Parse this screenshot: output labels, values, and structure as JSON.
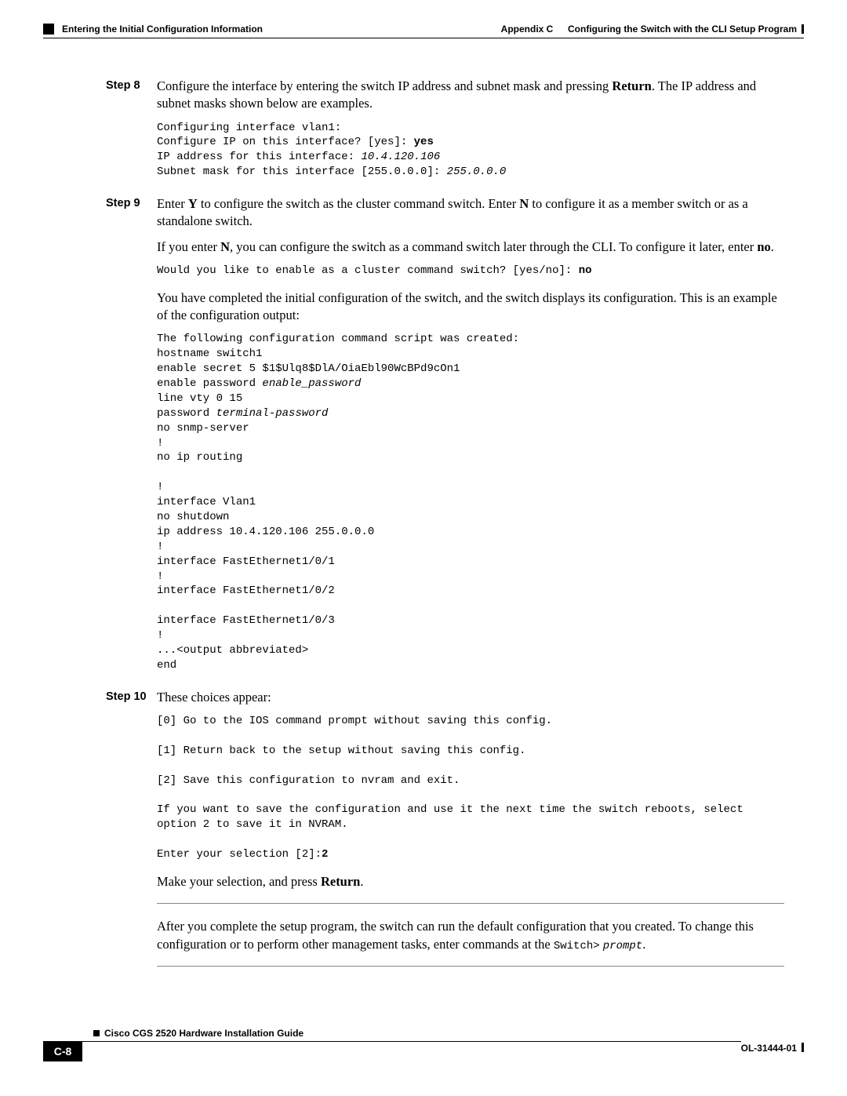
{
  "header": {
    "appendix": "Appendix C",
    "appendix_title": "Configuring the Switch with the CLI Setup Program",
    "section": "Entering the Initial Configuration Information"
  },
  "step8": {
    "label": "Step 8",
    "p1_a": "Configure the interface by entering the switch IP address and subnet mask and pressing ",
    "p1_b": "Return",
    "p1_c": ". The IP address and subnet masks shown below are examples.",
    "code_l1": "Configuring interface vlan1:",
    "code_l2a": "Configure IP on this interface? [yes]: ",
    "code_l2b": "yes",
    "code_l3a": "IP address for this interface: ",
    "code_l3b": "10.4.120.106",
    "code_l4a": "Subnet mask for this interface [255.0.0.0]: ",
    "code_l4b": "255.0.0.0"
  },
  "step9": {
    "label": "Step 9",
    "p1_a": "Enter ",
    "p1_b": "Y",
    "p1_c": " to configure the switch as the cluster command switch. Enter ",
    "p1_d": "N",
    "p1_e": " to configure it as a member switch or as a standalone switch.",
    "p2_a": "If you enter ",
    "p2_b": "N",
    "p2_c": ", you can configure the switch as a command switch later through the CLI. To configure it later, enter ",
    "p2_d": "no",
    "p2_e": ".",
    "code1_a": "Would you like to enable as a cluster command switch? [yes/no]: ",
    "code1_b": "no",
    "p3": "You have completed the initial configuration of the switch, and the switch displays its configuration. This is an example of the configuration output:",
    "code2_p1": "The following configuration command script was created:\nhostname switch1\nenable secret 5 $1$Ulq8$DlA/OiaEbl90WcBPd9cOn1",
    "code2_p2a": "enable password ",
    "code2_p2b": "enable_password",
    "code2_p3": "line vty 0 15",
    "code2_p4a": "password ",
    "code2_p4b": "terminal-password",
    "code2_p5": "no snmp-server\n!\nno ip routing\n\n!\ninterface Vlan1\nno shutdown\nip address 10.4.120.106 255.0.0.0\n!\ninterface FastEthernet1/0/1\n!\ninterface FastEthernet1/0/2\n\ninterface FastEthernet1/0/3\n!\n...<output abbreviated>\nend"
  },
  "step10": {
    "label": "Step 10",
    "p1": "These choices appear:",
    "code_a": "[0] Go to the IOS command prompt without saving this config.\n\n[1] Return back to the setup without saving this config.\n\n[2] Save this configuration to nvram and exit.\n\nIf you want to save the configuration and use it the next time the switch reboots, select\noption 2 to save it in NVRAM.\n\nEnter your selection [2]:",
    "code_b": "2",
    "p2_a": "Make your selection, and press ",
    "p2_b": "Return",
    "p2_c": "."
  },
  "closing": {
    "p_a": "After you complete the setup program, the switch can run the default configuration that you created. To change this configuration or to perform other management tasks, enter commands at the ",
    "p_b": "Switch>",
    "p_c": " ",
    "p_d": "prompt",
    "p_e": "."
  },
  "footer": {
    "book": "Cisco CGS 2520 Hardware Installation Guide",
    "page": "C-8",
    "docnum": "OL-31444-01"
  }
}
